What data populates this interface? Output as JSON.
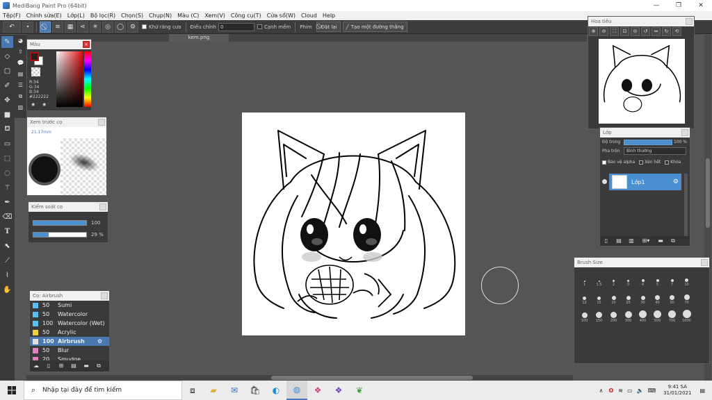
{
  "window": {
    "title": "MediBang Paint Pro (64bit)",
    "controls": [
      "—",
      "❐",
      "✕"
    ]
  },
  "menu": [
    "Tệp(F)",
    "Chỉnh sửa(E)",
    "Lớp(L)",
    "Bộ lọc(R)",
    "Chọn(S)",
    "Chụp(N)",
    "Màu (C)",
    "Xem(V)",
    "Công cụ(T)",
    "Cửa sổ(W)",
    "Cloud",
    "Help"
  ],
  "toolbar": {
    "antialias_label": "Khử răng cưa",
    "adjust_label": "Điều chỉnh",
    "adjust_value": "0",
    "edge_label": "Cạnh mềm",
    "key_label": "Phím",
    "reset_label": "Đặt lại",
    "create_line_label": "Tạo một đường thẳng"
  },
  "document": {
    "tab_name": "kem.png"
  },
  "color_panel": {
    "title": "Màu",
    "r_label": "R:34",
    "g_label": "G:34",
    "b_label": "B:34",
    "hex_label": "#222222"
  },
  "brush_preview": {
    "title": "Xem trước cọ",
    "size_label": "21.17mm"
  },
  "brush_control": {
    "title": "Kiểm soát cọ",
    "size_value": "100",
    "opacity_value": "29 %",
    "size_fraction": 1.0,
    "opacity_fraction": 0.29
  },
  "brush_list": {
    "title": "Cọ: Airbrush",
    "items": [
      {
        "num": "50",
        "name": "Sumi",
        "color": "#5ac0f0"
      },
      {
        "num": "50",
        "name": "Watercolor",
        "color": "#5ac0f0"
      },
      {
        "num": "100",
        "name": "Watercolor (Wet)",
        "color": "#5ac0f0"
      },
      {
        "num": "50",
        "name": "Acrylic",
        "color": "#f0d040"
      },
      {
        "num": "100",
        "name": "Airbrush",
        "color": "#e0e0e0",
        "selected": true
      },
      {
        "num": "50",
        "name": "Blur",
        "color": "#e080c0"
      },
      {
        "num": "20",
        "name": "Smudge",
        "color": "#e080c0"
      }
    ]
  },
  "navigator": {
    "title": "Hoa tiêu"
  },
  "layer_panel": {
    "title": "Lớp",
    "opacity_label": "Độ trong",
    "opacity_value": "100 %",
    "opacity_fraction": 1.0,
    "blend_label": "Pha trộn",
    "blend_value": "Bình thường",
    "protect_alpha": "Bảo vệ alpha",
    "clipping": "Xén hết",
    "lock": "Khóa",
    "layer_name": "Lớp1"
  },
  "brush_size": {
    "title": "Brush Size",
    "sizes": [
      [
        "1",
        "1.5",
        "2",
        "3",
        "4",
        "5",
        "7",
        "10"
      ],
      [
        "12",
        "15",
        "20",
        "25",
        "30",
        "40",
        "50",
        "70"
      ],
      [
        "100",
        "150",
        "200",
        "300",
        "400",
        "500",
        "700",
        "1000"
      ]
    ]
  },
  "taskbar": {
    "search_placeholder": "Nhập tại đây để tìm kiếm",
    "time": "9:41 SA",
    "date": "31/01/2021"
  }
}
